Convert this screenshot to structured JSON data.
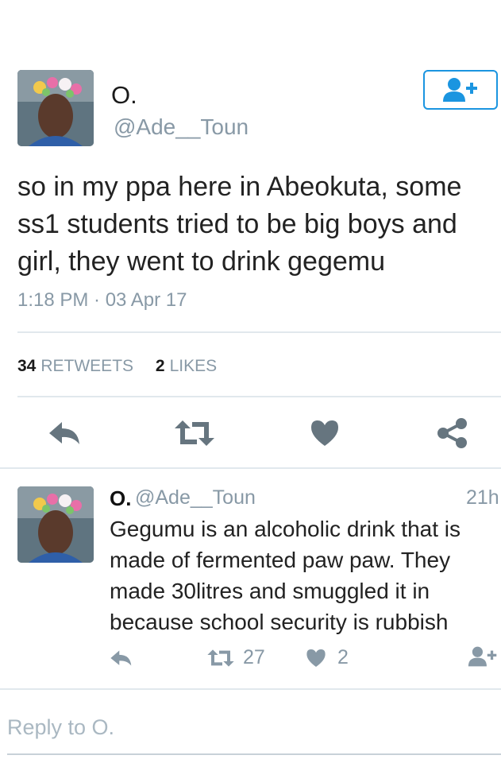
{
  "tweet": {
    "name": "O.",
    "handle": "@Ade__Toun",
    "text": "so in my ppa here in Abeokuta, some ss1 students tried to be big boys and girl, they went to drink gegemu",
    "timestamp": "1:18 PM · 03 Apr 17",
    "retweets_count": "34",
    "retweets_label": "RETWEETS",
    "likes_count": "2",
    "likes_label": "LIKES"
  },
  "actions": {
    "icons": [
      "reply-icon",
      "retweet-icon",
      "heart-icon",
      "share-icon"
    ]
  },
  "reply_tweet": {
    "name": "O.",
    "handle": "@Ade__Toun",
    "time": "21h",
    "text": "Gegumu is an alcoholic drink that is made of fermented paw paw. They made 30litres and smuggled it in because school security is rubbish",
    "retweet_count": "27",
    "like_count": "2"
  },
  "composer": {
    "placeholder": "Reply to O."
  },
  "colors": {
    "accent": "#1b95e0",
    "icon_gray": "#66757f",
    "muted_text": "#8899a6",
    "divider": "#e1e8ed"
  }
}
